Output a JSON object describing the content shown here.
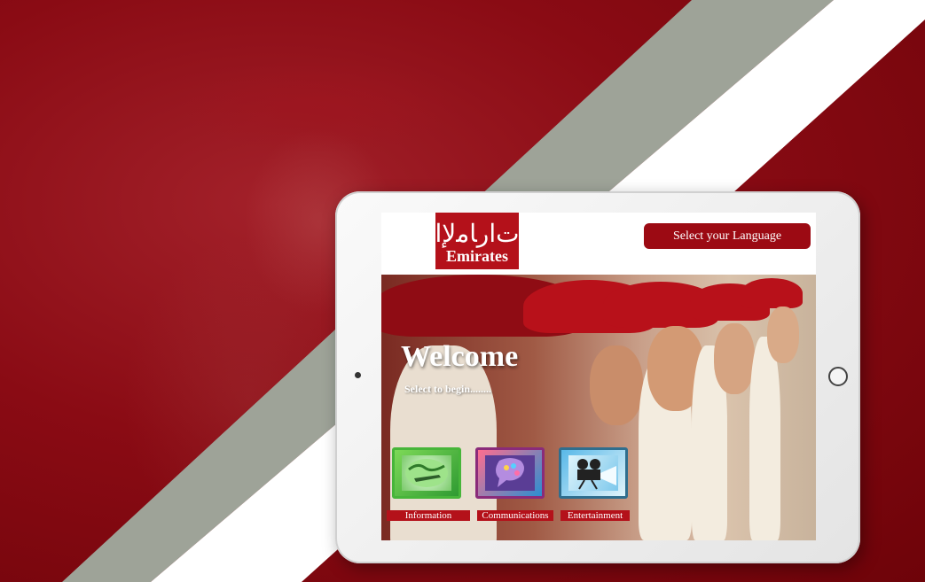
{
  "header": {
    "logo_text": "Emirates",
    "logo_mark": "ﺕﺍﺭﺎﻣﻹﺍ",
    "language_button": "Select your Language"
  },
  "hero": {
    "title": "Welcome",
    "subtitle": "Select to begin........"
  },
  "tiles": [
    {
      "label": "Information",
      "icon": "globe-plane-icon"
    },
    {
      "label": "Communications",
      "icon": "speech-world-icon"
    },
    {
      "label": "Entertainment",
      "icon": "movie-projector-icon"
    }
  ],
  "colors": {
    "brand_red": "#b4111a",
    "button_red": "#9c0a13",
    "stripe_gray": "#9ea398"
  }
}
